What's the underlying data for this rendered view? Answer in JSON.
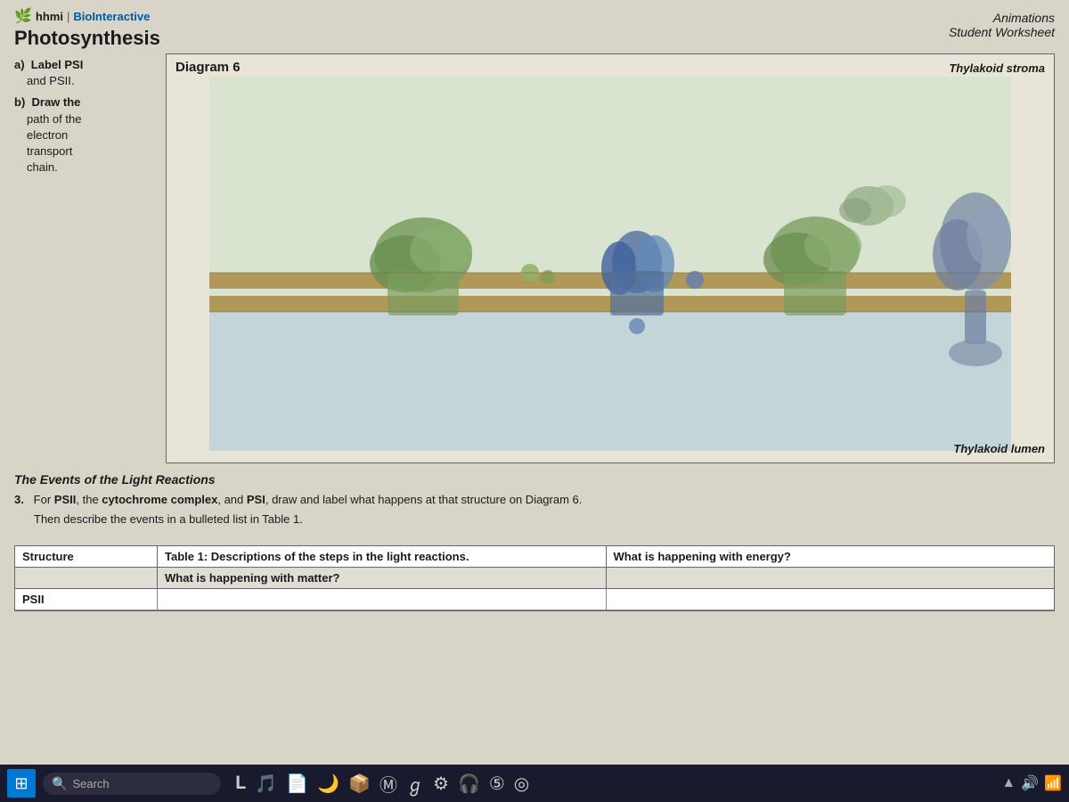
{
  "brand": {
    "prefix": "hhmi",
    "name": "BioInteractive"
  },
  "page": {
    "title": "Photosynthesis",
    "type_label": "Animations",
    "subtitle": "Student Worksheet"
  },
  "questions": {
    "a": {
      "label": "a)",
      "text_line1": "Label PSI",
      "text_line2": "and PSII."
    },
    "b": {
      "label": "b)",
      "text_line1": "Draw the",
      "text_line2": "path of the",
      "text_line3": "electron",
      "text_line4": "transport",
      "text_line5": "chain."
    }
  },
  "diagram": {
    "title": "Diagram 6",
    "label_stroma": "Thylakoid stroma",
    "label_lumen": "Thylakoid lumen"
  },
  "events_section": {
    "title": "The Events of the Light Reactions",
    "instruction_number": "3.",
    "instruction_text": "For PSII, the cytochrome complex, and PSI, draw and label what happens at that structure on Diagram 6.",
    "instruction_sub": "Then describe the events in a bulleted list in Table 1."
  },
  "table": {
    "title": "Table 1: Descriptions of the steps in the light reactions.",
    "col1_header": "Structure",
    "col2_header": "What is happening with matter?",
    "col3_header": "What is happening with energy?",
    "rows": [
      {
        "structure": "PSII",
        "matter": "",
        "energy": ""
      }
    ]
  },
  "taskbar": {
    "search_placeholder": "Search"
  }
}
